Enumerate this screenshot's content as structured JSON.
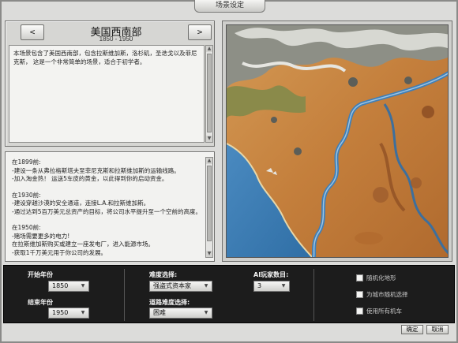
{
  "window": {
    "title": "场景设定"
  },
  "scenario": {
    "prev_label": "<",
    "next_label": ">",
    "name": "美国西南部",
    "years": "1850 - 1950",
    "description": "本场景包含了美国西南部，包含拉斯维加斯，洛杉矶，圣迭戈以及菲尼克斯，  这是一个非常简单的场景，适合于初学者。"
  },
  "goals": [
    {
      "heading": "在1899前:",
      "lines": [
        "-建设一条从弗拉格斯塔夫至菲尼克斯和拉斯维加斯的运输线路。",
        "-加入淘金热！  运送5车皮的黄金，以此得到你的启动资金。"
      ]
    },
    {
      "heading": "在1930前:",
      "lines": [
        "-建设穿越沙漠的安全通道，连接L.A.和拉斯维加斯。",
        "-通过达到5百万美元总资产的目标，将公司水平提升至一个空前的高度。"
      ]
    },
    {
      "heading": "在1950前:",
      "lines": [
        "-赌场需要更多的电力!",
        "在拉斯维加斯购买或建立一座发电厂，进入能源市场。",
        "-获取1千万美元用于你公司的发展。"
      ]
    }
  ],
  "settings": {
    "start_year_label": "开始年份",
    "start_year_value": "1850",
    "end_year_label": "结束年份",
    "end_year_value": "1950",
    "difficulty_label": "难度选择:",
    "difficulty_value": "强盗式资本家",
    "track_difficulty_label": "道路难度选择:",
    "track_difficulty_value": "困难",
    "ai_players_label": "AI玩家数目:",
    "ai_players_value": "3",
    "options": [
      {
        "label": "随机化地形",
        "checked": false
      },
      {
        "label": "为城市随机选择",
        "checked": false
      },
      {
        "label": "使用所有机车",
        "checked": false
      }
    ]
  },
  "footer": {
    "ok_label": "确定",
    "cancel_label": "取消"
  },
  "colors": {
    "settings_bg": "#1c1c1c",
    "panel_bg": "#f2f2f0",
    "water": "#3f7fb8",
    "desert": "#c98a45"
  },
  "icons": {
    "dropdown": "chevron-down-icon",
    "scroll_up": "arrow-up-icon",
    "scroll_down": "arrow-down-icon"
  }
}
